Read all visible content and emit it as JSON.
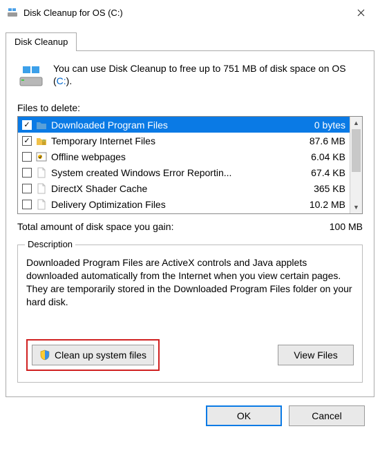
{
  "window": {
    "title": "Disk Cleanup for OS (C:)"
  },
  "tab": {
    "label": "Disk Cleanup"
  },
  "intro": {
    "text_before_drive": "You can use Disk Cleanup to free up to 751 MB of disk space on OS (",
    "drive_label": "C:",
    "text_after_drive": ")."
  },
  "files_label": "Files to delete:",
  "rows": [
    {
      "checked": true,
      "icon": "folder-blue",
      "name": "Downloaded Program Files",
      "size": "0 bytes",
      "selected": true
    },
    {
      "checked": true,
      "icon": "folder-lock",
      "name": "Temporary Internet Files",
      "size": "87.6 MB",
      "selected": false
    },
    {
      "checked": false,
      "icon": "offline",
      "name": "Offline webpages",
      "size": "6.04 KB",
      "selected": false
    },
    {
      "checked": false,
      "icon": "file",
      "name": "System created Windows Error Reportin...",
      "size": "67.4 KB",
      "selected": false
    },
    {
      "checked": false,
      "icon": "file",
      "name": "DirectX Shader Cache",
      "size": "365 KB",
      "selected": false
    },
    {
      "checked": false,
      "icon": "file",
      "name": "Delivery Optimization Files",
      "size": "10.2 MB",
      "selected": false
    }
  ],
  "total": {
    "label": "Total amount of disk space you gain:",
    "value": "100 MB"
  },
  "desc": {
    "heading": "Description",
    "text": "Downloaded Program Files are ActiveX controls and Java applets downloaded automatically from the Internet when you view certain pages. They are temporarily stored in the Downloaded Program Files folder on your hard disk."
  },
  "buttons": {
    "cleanup_system": "Clean up system files",
    "view_files": "View Files",
    "ok": "OK",
    "cancel": "Cancel"
  }
}
